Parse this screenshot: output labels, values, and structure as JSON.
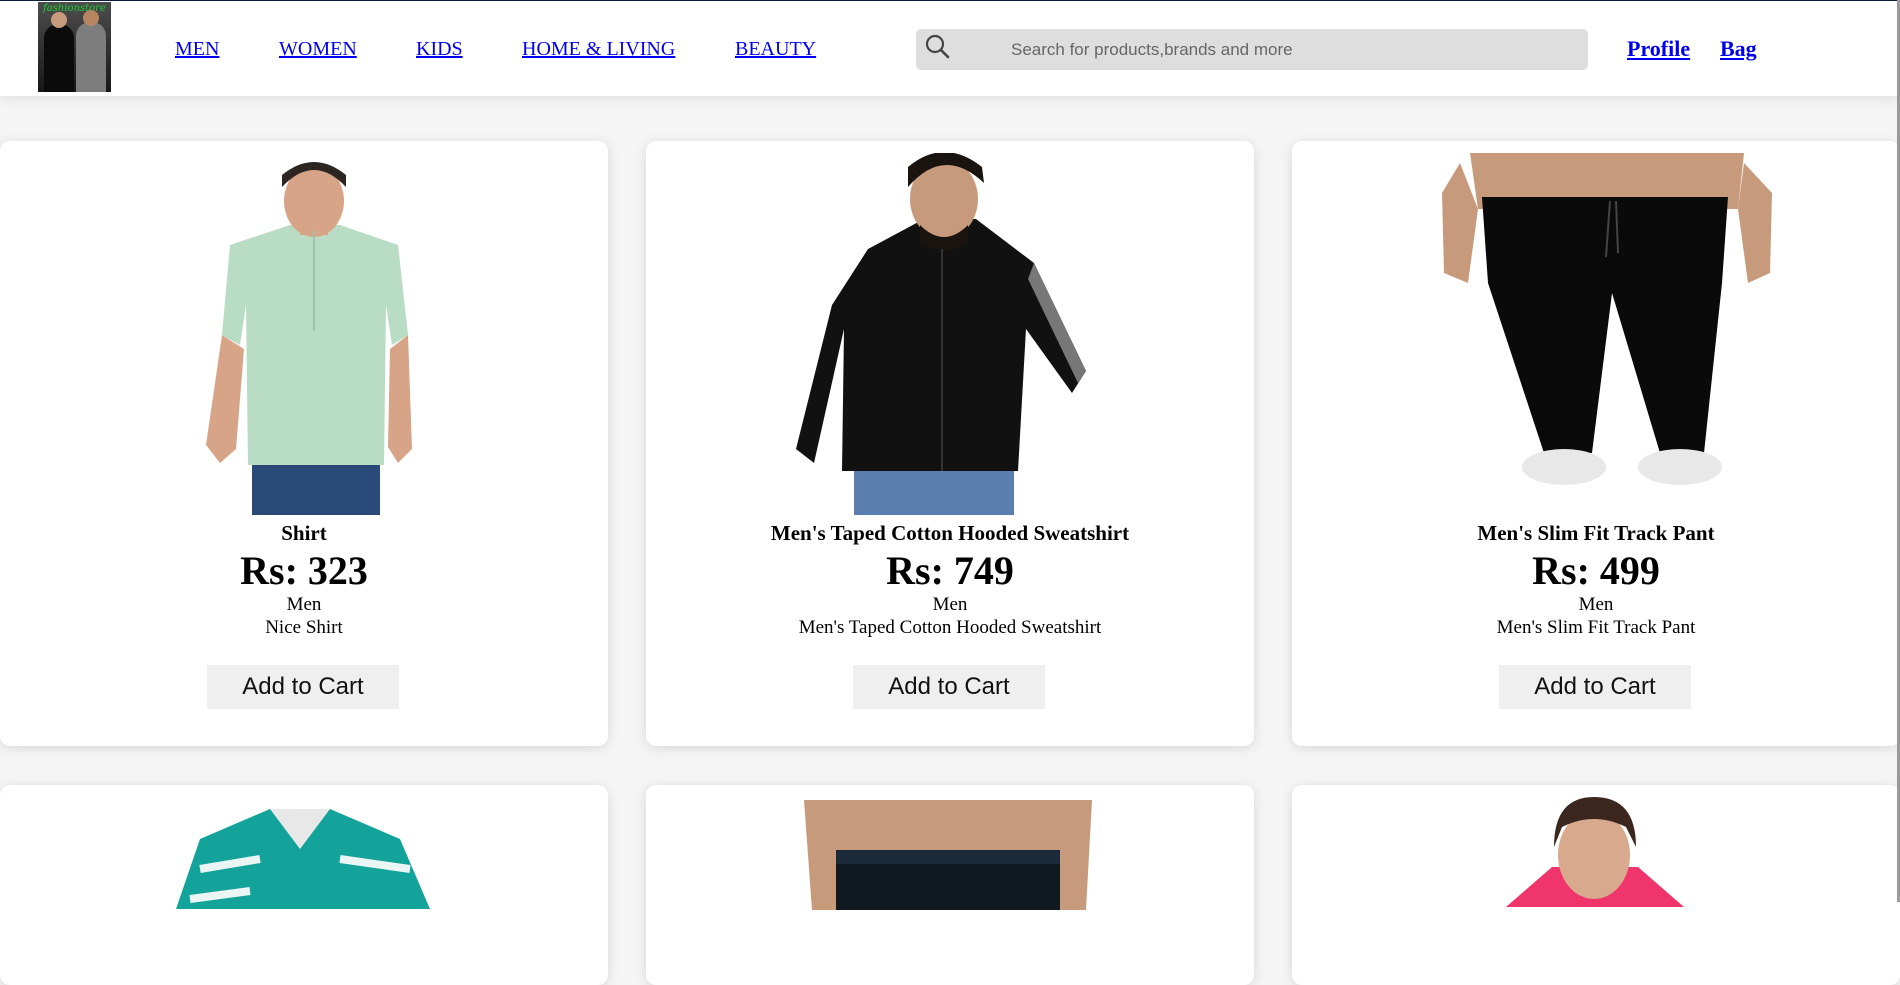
{
  "header": {
    "logo": {
      "text": "fashionstore"
    },
    "nav": [
      {
        "label": "MEN"
      },
      {
        "label": "WOMEN"
      },
      {
        "label": "KIDS"
      },
      {
        "label": "HOME & LIVING"
      },
      {
        "label": "BEAUTY"
      }
    ],
    "search": {
      "placeholder": "Search for products,brands and more",
      "icon": "search-icon"
    },
    "profile_label": "Profile",
    "bag_label": "Bag"
  },
  "products": [
    {
      "name": "Shirt",
      "price": "Rs: 323",
      "category": "Men",
      "description": "Nice Shirt",
      "button": "Add to Cart"
    },
    {
      "name": "Men's Taped Cotton Hooded Sweatshirt",
      "price": "Rs: 749",
      "category": "Men",
      "description": "Men's Taped Cotton Hooded Sweatshirt",
      "button": "Add to Cart"
    },
    {
      "name": "Men's Slim Fit Track Pant",
      "price": "Rs: 499",
      "category": "Men",
      "description": "Men's Slim Fit Track Pant",
      "button": "Add to Cart"
    }
  ],
  "partial_products": [
    {
      "image": "teal-printed-shirt"
    },
    {
      "image": "jockey-briefs"
    },
    {
      "image": "pink-hoodie-woman"
    }
  ],
  "colors": {
    "link": "#0000ee",
    "page_bg": "#f5f5f5",
    "card_bg": "#ffffff",
    "button_bg": "#efefef"
  }
}
